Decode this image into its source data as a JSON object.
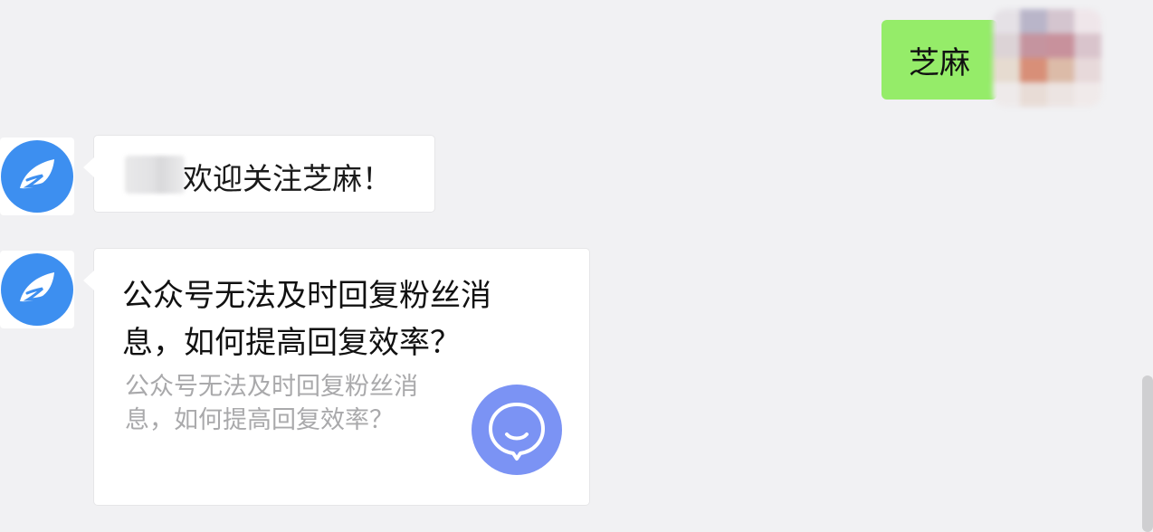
{
  "outgoing": {
    "text": "芝麻"
  },
  "messages": {
    "welcome": "欢迎关注芝麻！",
    "card_title": "公众号无法及时回复粉丝消息，如何提高回复效率？",
    "card_description": "公众号无法及时回复粉丝消息，如何提高回复效率？"
  },
  "colors": {
    "outgoing_bubble": "#95ec69",
    "background": "#f1f1f3",
    "card_icon": "#7b93f4",
    "bot_avatar_accent": "#3d8ff0"
  },
  "icons": {
    "bot_avatar": "blue-leaf-logo",
    "card_icon": "chat-smile-bubble-icon"
  }
}
